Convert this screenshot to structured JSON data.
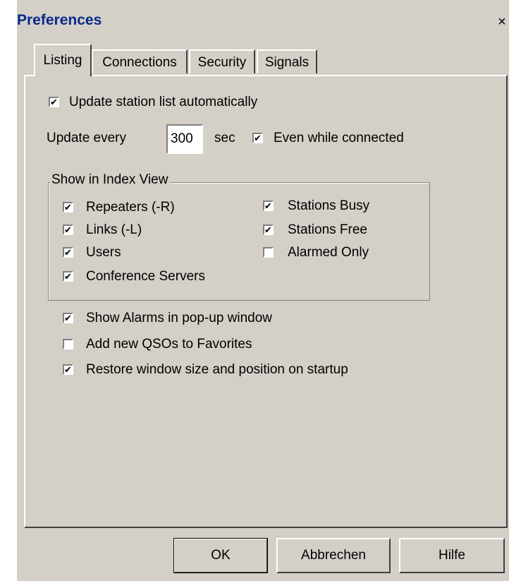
{
  "window": {
    "title": "Preferences",
    "close_glyph": "×"
  },
  "tabs": [
    {
      "label": "Listing",
      "active": true
    },
    {
      "label": "Connections",
      "active": false
    },
    {
      "label": "Security",
      "active": false
    },
    {
      "label": "Signals",
      "active": false
    }
  ],
  "listing": {
    "update_auto": {
      "label": "Update station list automatically",
      "checked": true
    },
    "update_every_label": "Update every",
    "update_every_value": "300",
    "sec_label": "sec",
    "even_connected": {
      "label": "Even while connected",
      "checked": true
    },
    "index_view": {
      "title": "Show in Index View",
      "left": [
        {
          "label": "Repeaters (-R)",
          "checked": true
        },
        {
          "label": "Links (-L)",
          "checked": true
        },
        {
          "label": "Users",
          "checked": true
        },
        {
          "label": "Conference Servers",
          "checked": true
        }
      ],
      "right": [
        {
          "label": "Stations Busy",
          "checked": true
        },
        {
          "label": "Stations Free",
          "checked": true
        },
        {
          "label": "Alarmed Only",
          "checked": false
        }
      ]
    },
    "options": [
      {
        "label": "Show Alarms in pop-up window",
        "checked": true
      },
      {
        "label": "Add new QSOs to Favorites",
        "checked": false
      },
      {
        "label": "Restore window size and position on startup",
        "checked": true
      }
    ]
  },
  "buttons": {
    "ok": "OK",
    "cancel": "Abbrechen",
    "help": "Hilfe"
  },
  "colors": {
    "face": "#d4d0c8",
    "title": "#0a2a8a",
    "check": "✔"
  }
}
